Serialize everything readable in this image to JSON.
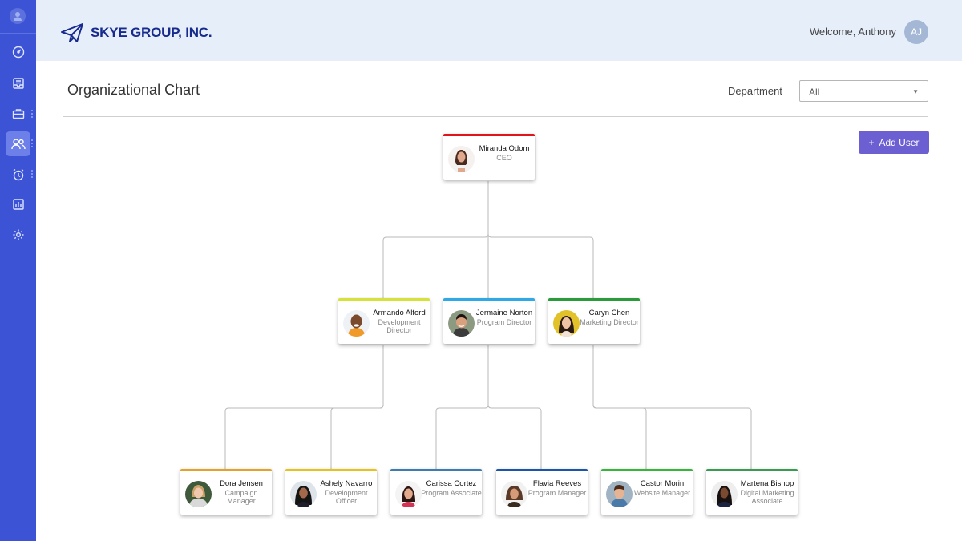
{
  "app": {
    "company": "SKYE GROUP, INC.",
    "welcome": "Welcome, Anthony",
    "user_initials": "AJ",
    "accent_color": "#3b53d4",
    "button_color": "#6c5fd1"
  },
  "sidebar": {
    "items": [
      {
        "icon": "dashboard-icon",
        "active": false
      },
      {
        "icon": "inbox-icon",
        "active": false
      },
      {
        "icon": "briefcase-icon",
        "active": false
      },
      {
        "icon": "users-icon",
        "active": true
      },
      {
        "icon": "alarm-clock-icon",
        "active": false
      },
      {
        "icon": "report-chart-icon",
        "active": false
      },
      {
        "icon": "settings-gear-icon",
        "active": false
      }
    ]
  },
  "page": {
    "title": "Organizational Chart",
    "department_label": "Department",
    "department_value": "All",
    "add_user_label": "Add User"
  },
  "org": {
    "ceo": {
      "name": "Miranda Odom",
      "role": "CEO",
      "color": "#e0141b"
    },
    "directors": [
      {
        "name": "Armando Alford",
        "role": "Development Director",
        "color": "#d6e23a"
      },
      {
        "name": "Jermaine Norton",
        "role": "Program Director",
        "color": "#2ea9e6"
      },
      {
        "name": "Caryn Chen",
        "role": "Marketing Director",
        "color": "#2a9a3a"
      }
    ],
    "staff": [
      {
        "name": "Dora Jensen",
        "role": "Campaign Manager",
        "color": "#e3a32a"
      },
      {
        "name": "Ashely Navarro",
        "role": "Development Officer",
        "color": "#e6c21d"
      },
      {
        "name": "Carissa Cortez",
        "role": "Program Associate",
        "color": "#3f7cae"
      },
      {
        "name": "Flavia Reeves",
        "role": "Program Manager",
        "color": "#1c55a8"
      },
      {
        "name": "Castor Morin",
        "role": "Website Manager",
        "color": "#37b43c"
      },
      {
        "name": "Martena Bishop",
        "role": "Digital Marketing Associate",
        "color": "#3b9a52"
      }
    ]
  }
}
